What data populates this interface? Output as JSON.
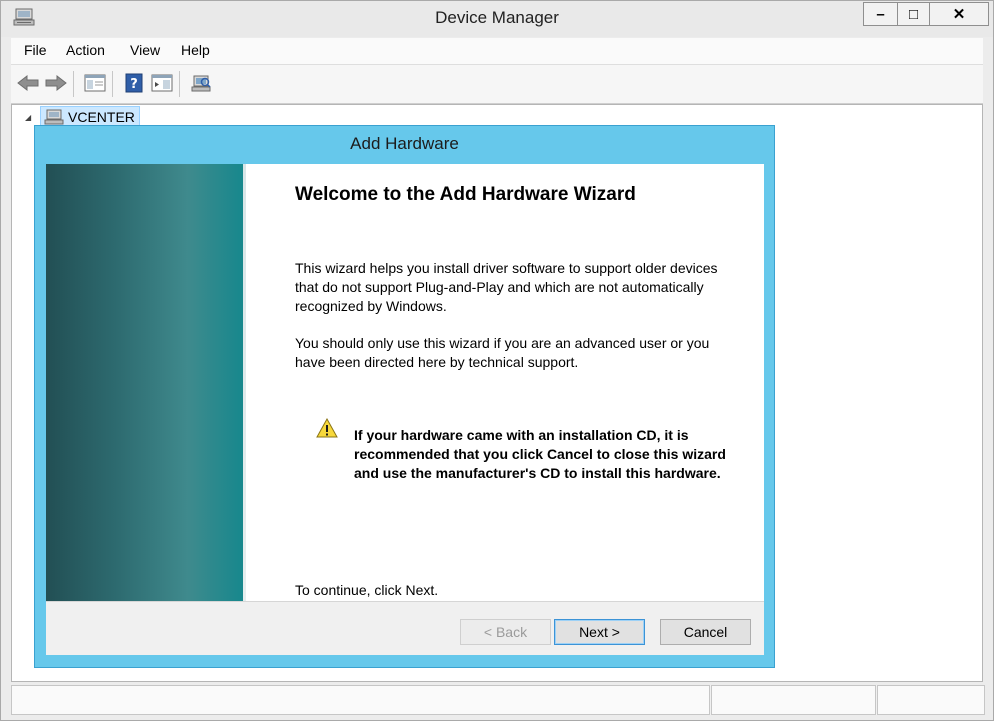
{
  "window": {
    "title": "Device Manager",
    "caption_buttons": {
      "minimize": "–",
      "maximize": "□",
      "close": "✕"
    }
  },
  "menu": {
    "items": [
      "File",
      "Action",
      "View",
      "Help"
    ]
  },
  "toolbar": {
    "icons": [
      "back-arrow-icon",
      "forward-arrow-icon",
      "show-hide-tree-icon",
      "help-icon",
      "properties-pane-icon",
      "scan-hardware-icon"
    ]
  },
  "tree": {
    "root_label": "VCENTER"
  },
  "dialog": {
    "title": "Add Hardware",
    "heading": "Welcome to the Add Hardware Wizard",
    "paragraph1": "This wizard helps you install driver software to support older devices that do not support Plug-and-Play and which are not automatically recognized by Windows.",
    "paragraph2": "You should only use this wizard if you are an advanced user or you have been directed here by technical support.",
    "warning": "If your hardware came with an installation CD, it is recommended that you click Cancel to close this wizard and use the manufacturer's CD to install this hardware.",
    "continue_hint": "To continue, click Next.",
    "buttons": {
      "back": "< Back",
      "next": "Next >",
      "cancel": "Cancel"
    }
  },
  "colors": {
    "dialog_frame": "#66c8eb",
    "tree_selection": "#cce8ff",
    "banner": "#2d6a6f"
  }
}
